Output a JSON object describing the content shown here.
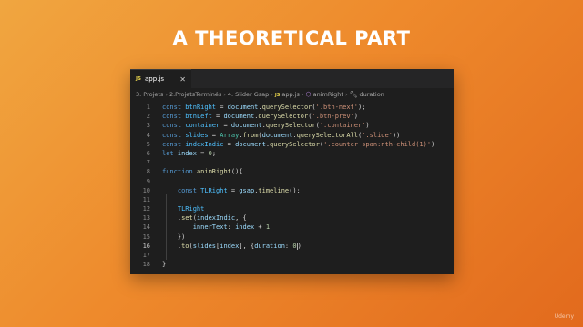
{
  "slide": {
    "title": "A THEORETICAL PART",
    "watermark": "Udemy"
  },
  "editor": {
    "tab": {
      "icon": "JS",
      "label": "app.js",
      "close": "✕"
    },
    "breadcrumb": {
      "items": [
        "3. Projets",
        "2.ProjetsTerminés",
        "4. Slider Gsap",
        "app.js",
        "animRight",
        "duration"
      ],
      "separator": "›"
    },
    "active_line": 16,
    "lines": [
      {
        "n": "1",
        "tokens": [
          [
            "k",
            "const "
          ],
          [
            "v",
            "btnRight"
          ],
          [
            "t",
            " = "
          ],
          [
            "p",
            "document"
          ],
          [
            "t",
            "."
          ],
          [
            "f",
            "querySelector"
          ],
          [
            "t",
            "("
          ],
          [
            "s",
            "'.btn-next'"
          ],
          [
            "t",
            ");"
          ]
        ]
      },
      {
        "n": "2",
        "tokens": [
          [
            "k",
            "const "
          ],
          [
            "v",
            "btnLeft"
          ],
          [
            "t",
            " = "
          ],
          [
            "p",
            "document"
          ],
          [
            "t",
            "."
          ],
          [
            "f",
            "querySelector"
          ],
          [
            "t",
            "("
          ],
          [
            "s",
            "'.btn-prev'"
          ],
          [
            "t",
            ")"
          ]
        ]
      },
      {
        "n": "3",
        "tokens": [
          [
            "k",
            "const "
          ],
          [
            "v",
            "container"
          ],
          [
            "t",
            " = "
          ],
          [
            "p",
            "document"
          ],
          [
            "t",
            "."
          ],
          [
            "f",
            "querySelector"
          ],
          [
            "t",
            "("
          ],
          [
            "s",
            "'.container'"
          ],
          [
            "t",
            ")"
          ]
        ]
      },
      {
        "n": "4",
        "tokens": [
          [
            "k",
            "const "
          ],
          [
            "v",
            "slides"
          ],
          [
            "t",
            " = "
          ],
          [
            "c",
            "Array"
          ],
          [
            "t",
            "."
          ],
          [
            "f",
            "from"
          ],
          [
            "t",
            "("
          ],
          [
            "p",
            "document"
          ],
          [
            "t",
            "."
          ],
          [
            "f",
            "querySelectorAll"
          ],
          [
            "t",
            "("
          ],
          [
            "s",
            "'.slide'"
          ],
          [
            "t",
            "))"
          ]
        ]
      },
      {
        "n": "5",
        "tokens": [
          [
            "k",
            "const "
          ],
          [
            "v",
            "indexIndic"
          ],
          [
            "t",
            " = "
          ],
          [
            "p",
            "document"
          ],
          [
            "t",
            "."
          ],
          [
            "f",
            "querySelector"
          ],
          [
            "t",
            "("
          ],
          [
            "s",
            "'.counter span:nth-child(1)'"
          ],
          [
            "t",
            ")"
          ]
        ]
      },
      {
        "n": "6",
        "tokens": [
          [
            "k",
            "let "
          ],
          [
            "p",
            "index"
          ],
          [
            "t",
            " = "
          ],
          [
            "n",
            "0"
          ],
          [
            "t",
            ";"
          ]
        ]
      },
      {
        "n": "7",
        "tokens": []
      },
      {
        "n": "8",
        "tokens": [
          [
            "k",
            "function "
          ],
          [
            "f",
            "animRight"
          ],
          [
            "t",
            "(){"
          ]
        ]
      },
      {
        "n": "9",
        "tokens": []
      },
      {
        "n": "10",
        "tokens": [
          [
            "t",
            "    "
          ],
          [
            "k",
            "const "
          ],
          [
            "v",
            "TLRight"
          ],
          [
            "t",
            " = "
          ],
          [
            "p",
            "gsap"
          ],
          [
            "t",
            "."
          ],
          [
            "f",
            "timeline"
          ],
          [
            "t",
            "();"
          ]
        ]
      },
      {
        "n": "11",
        "tokens": []
      },
      {
        "n": "12",
        "tokens": [
          [
            "t",
            "    "
          ],
          [
            "v",
            "TLRight"
          ]
        ]
      },
      {
        "n": "13",
        "tokens": [
          [
            "t",
            "    ."
          ],
          [
            "f",
            "set"
          ],
          [
            "t",
            "("
          ],
          [
            "p",
            "indexIndic"
          ],
          [
            "t",
            ", {"
          ]
        ]
      },
      {
        "n": "14",
        "tokens": [
          [
            "t",
            "        "
          ],
          [
            "p",
            "innerText"
          ],
          [
            "t",
            ": "
          ],
          [
            "p",
            "index"
          ],
          [
            "t",
            " + "
          ],
          [
            "n",
            "1"
          ]
        ]
      },
      {
        "n": "15",
        "tokens": [
          [
            "t",
            "    })"
          ]
        ]
      },
      {
        "n": "16",
        "tokens": [
          [
            "t",
            "    ."
          ],
          [
            "f",
            "to"
          ],
          [
            "t",
            "("
          ],
          [
            "p",
            "slides"
          ],
          [
            "t",
            "["
          ],
          [
            "p",
            "index"
          ],
          [
            "t",
            "], {"
          ],
          [
            "p",
            "duration"
          ],
          [
            "t",
            ": "
          ],
          [
            "n",
            "0"
          ],
          [
            "cursor",
            ""
          ],
          [
            "t",
            ")"
          ]
        ]
      },
      {
        "n": "17",
        "tokens": []
      },
      {
        "n": "18",
        "tokens": [
          [
            "t",
            "}"
          ]
        ]
      }
    ]
  }
}
